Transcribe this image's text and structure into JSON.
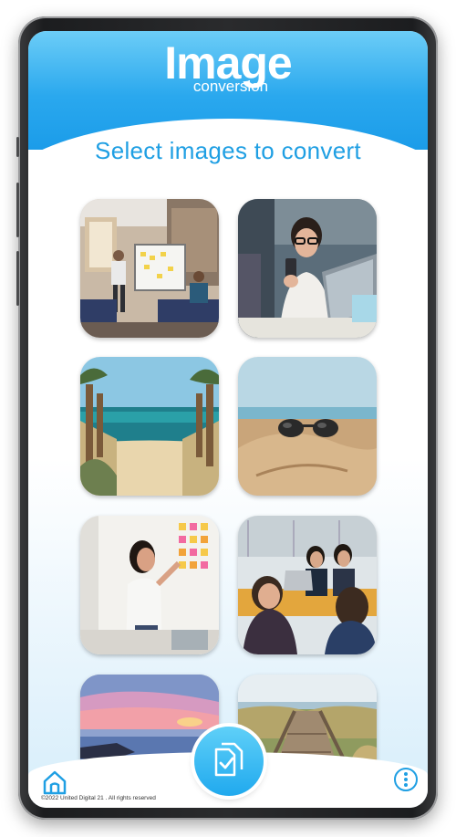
{
  "app": {
    "logo_title": "Image",
    "logo_subtitle": "conversion"
  },
  "page": {
    "heading": "Select images to convert"
  },
  "images": [
    {
      "name": "office-team-whiteboard"
    },
    {
      "name": "woman-with-phone-laptop"
    },
    {
      "name": "beach-path-sea"
    },
    {
      "name": "sunglasses-on-sand"
    },
    {
      "name": "woman-sticky-notes-wall"
    },
    {
      "name": "team-meeting-laptop"
    },
    {
      "name": "sunset-sea"
    },
    {
      "name": "wooden-boardwalk-dunes"
    }
  ],
  "bottom_nav": {
    "home_icon": "home-icon",
    "convert_icon": "convert-files-icon",
    "more_icon": "more-vertical-icon"
  },
  "footer": {
    "copyright": "©2022 United Digital 21 . All rights reserved"
  },
  "colors": {
    "accent": "#1f9fe3",
    "header_top": "#6ccdf7",
    "header_bottom": "#1b9ce9"
  }
}
